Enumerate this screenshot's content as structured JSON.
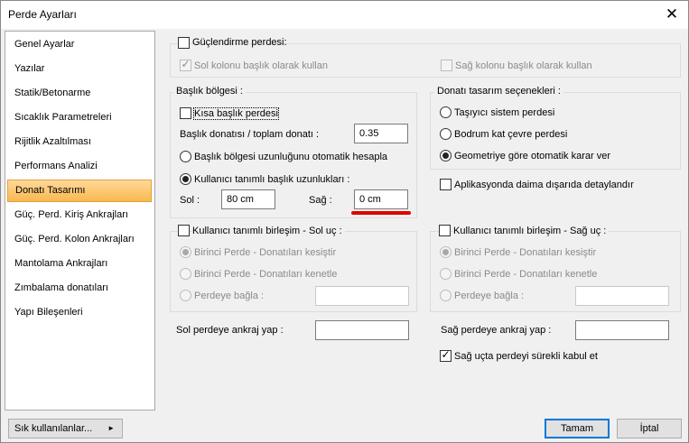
{
  "window": {
    "title": "Perde Ayarları"
  },
  "sidebar": {
    "items": [
      {
        "label": "Genel Ayarlar"
      },
      {
        "label": "Yazılar"
      },
      {
        "label": "Statik/Betonarme"
      },
      {
        "label": "Sıcaklık Parametreleri"
      },
      {
        "label": "Rijitlik Azaltılması"
      },
      {
        "label": "Performans Analizi"
      },
      {
        "label": "Donatı Tasarımı",
        "selected": true
      },
      {
        "label": "Güç. Perd. Kiriş Ankrajları"
      },
      {
        "label": "Güç. Perd. Kolon Ankrajları"
      },
      {
        "label": "Mantolama Ankrajları"
      },
      {
        "label": "Zımbalama donatıları"
      },
      {
        "label": "Yapı Bileşenleri"
      }
    ]
  },
  "strengthening": {
    "label": "Güçlendirme perdesi:",
    "checked": false,
    "left_column_header": "Sol kolonu başlık olarak kullan",
    "left_checked": true,
    "right_column_header": "Sağ kolonu başlık olarak kullan",
    "right_checked": false
  },
  "header_zone": {
    "title": "Başlık bölgesi :",
    "short_header_label": "Kısa başlık perdesi",
    "ratio_label": "Başlık donatısı / toplam donatı :",
    "ratio_value": "0.35",
    "auto_calc_label": "Başlık bölgesi uzunluğunu otomatik hesapla",
    "user_defined_label": "Kullanıcı tanımlı başlık uzunlukları :",
    "left_label": "Sol :",
    "left_value": "80 cm",
    "right_label": "Sağ :",
    "right_value": "0 cm"
  },
  "rebar_options": {
    "title": "Donatı tasarım seçenekleri :",
    "options": [
      {
        "label": "Taşıyıcı sistem perdesi",
        "selected": false
      },
      {
        "label": "Bodrum kat çevre perdesi",
        "selected": false
      },
      {
        "label": "Geometriye göre otomatik karar ver",
        "selected": true
      }
    ],
    "detail_label": "Aplikasyonda daima dışarıda detaylandır"
  },
  "left_joint": {
    "title": "Kullanıcı tanımlı birleşim - Sol uç :",
    "option1": "Birinci Perde - Donatıları kesiştir",
    "option2": "Birinci Perde - Donatıları kenetle",
    "option3": "Perdeye bağla :",
    "input_value": ""
  },
  "right_joint": {
    "title": "Kullanıcı tanımlı birleşim - Sağ uç :",
    "option1": "Birinci Perde - Donatıları kesiştir",
    "option2": "Birinci Perde - Donatıları kenetle",
    "option3": "Perdeye bağla :",
    "input_value": ""
  },
  "anchorage": {
    "left_label": "Sol perdeye ankraj yap :",
    "left_value": "",
    "right_label": "Sağ perdeye ankraj yap :",
    "right_value": "",
    "continuous_label": "Sağ uçta perdeyi sürekli kabul et",
    "continuous_checked": true
  },
  "footer": {
    "frequent_label": "Sık kullanılanlar...",
    "frequent_arrow": "►",
    "ok_label": "Tamam",
    "cancel_label": "İptal"
  },
  "colors": {
    "selected_item": "#f9b84f",
    "annotation": "#e00000",
    "default_button": "#0078d7"
  }
}
